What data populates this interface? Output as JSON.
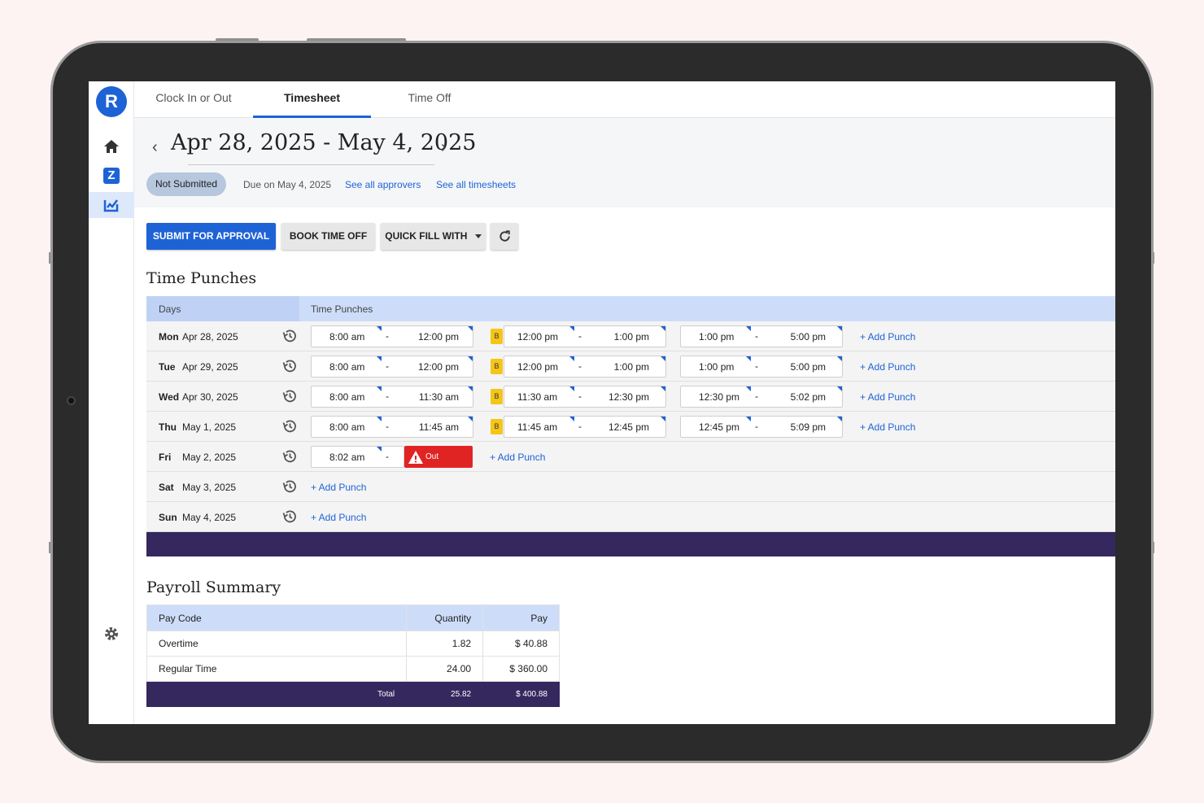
{
  "app": {
    "logo_letter": "R",
    "accent": "#1e63d6",
    "footer_color": "#35285f"
  },
  "sidebar": {
    "items": [
      {
        "icon": "home-icon"
      },
      {
        "icon": "z-app-icon",
        "letter": "Z"
      },
      {
        "icon": "timesheet-icon"
      }
    ],
    "settings_icon": "gear-icon"
  },
  "tabs": [
    {
      "label": "Clock In or Out"
    },
    {
      "label": "Timesheet"
    },
    {
      "label": "Time Off"
    }
  ],
  "header": {
    "date_range": "Apr 28, 2025 - May 4, 2025",
    "prev_icon": "‹",
    "next_icon": "›",
    "status": "Not Submitted",
    "due": "Due on May 4, 2025",
    "see_approvers": "See all approvers",
    "see_timesheets": "See all timesheets"
  },
  "actions": {
    "submit": "SUBMIT FOR APPROVAL",
    "book_time_off": "BOOK TIME OFF",
    "quick_fill": "QUICK FILL WITH",
    "refresh_icon": "refresh-icon"
  },
  "punches": {
    "title": "Time Punches",
    "col_days": "Days",
    "col_punches": "Time Punches",
    "add_punch": "+ Add Punch",
    "break_label": "B",
    "out_label": "Out",
    "dash": "-",
    "rows": [
      {
        "day": "Mon",
        "date": "Apr 28, 2025",
        "p1": [
          "8:00 am",
          "12:00 pm"
        ],
        "p2": [
          "12:00 pm",
          "1:00 pm"
        ],
        "p3": [
          "1:00 pm",
          "5:00 pm"
        ]
      },
      {
        "day": "Tue",
        "date": "Apr 29, 2025",
        "p1": [
          "8:00 am",
          "12:00 pm"
        ],
        "p2": [
          "12:00 pm",
          "1:00 pm"
        ],
        "p3": [
          "1:00 pm",
          "5:00 pm"
        ]
      },
      {
        "day": "Wed",
        "date": "Apr 30, 2025",
        "p1": [
          "8:00 am",
          "11:30 am"
        ],
        "p2": [
          "11:30 am",
          "12:30 pm"
        ],
        "p3": [
          "12:30 pm",
          "5:02 pm"
        ]
      },
      {
        "day": "Thu",
        "date": "May 1, 2025",
        "p1": [
          "8:00 am",
          "11:45 am"
        ],
        "p2": [
          "11:45 am",
          "12:45 pm"
        ],
        "p3": [
          "12:45 pm",
          "5:09 pm"
        ]
      },
      {
        "day": "Fri",
        "date": "May 2, 2025",
        "p1": [
          "8:02 am"
        ]
      },
      {
        "day": "Sat",
        "date": "May 3, 2025"
      },
      {
        "day": "Sun",
        "date": "May 4, 2025"
      }
    ]
  },
  "payroll": {
    "title": "Payroll Summary",
    "col_code": "Pay Code",
    "col_qty": "Quantity",
    "col_pay": "Pay",
    "rows": [
      {
        "code": "Overtime",
        "qty": "1.82",
        "pay": "$ 40.88"
      },
      {
        "code": "Regular Time",
        "qty": "24.00",
        "pay": "$ 360.00"
      }
    ],
    "total_label": "Total",
    "total_qty": "25.82",
    "total_pay": "$ 400.88"
  }
}
